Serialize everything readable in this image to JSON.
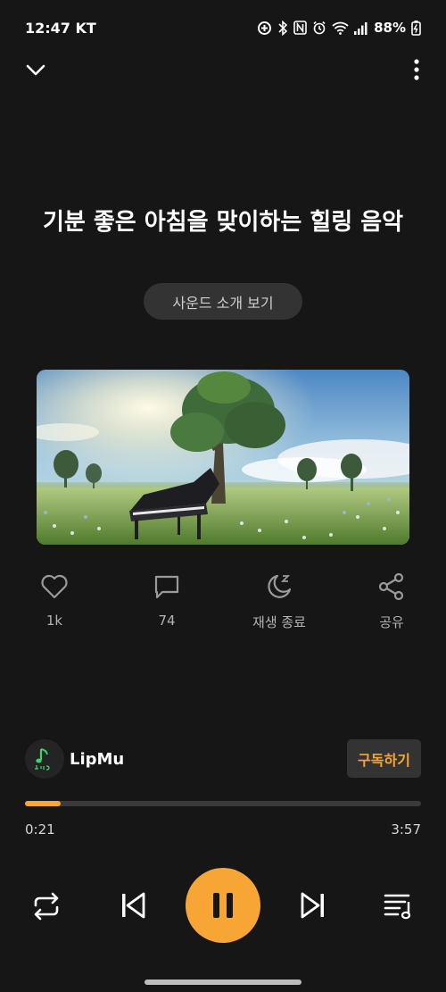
{
  "status_bar": {
    "time": "12:47",
    "carrier": "KT",
    "battery": "88%"
  },
  "track": {
    "title": "기분 좋은 아침을 맞이하는 힐링 음악",
    "intro_button": "사운드 소개 보기"
  },
  "actions": [
    {
      "icon": "heart-icon",
      "label": "1k"
    },
    {
      "icon": "comment-icon",
      "label": "74"
    },
    {
      "icon": "sleep-timer-icon",
      "label": "재생 종료"
    },
    {
      "icon": "share-icon",
      "label": "공유"
    }
  ],
  "channel": {
    "name": "LipMu",
    "subscribe_label": "구독하기"
  },
  "player": {
    "current_time": "0:21",
    "total_time": "3:57",
    "progress": 0.089,
    "state": "playing"
  },
  "colors": {
    "accent": "#f7a534",
    "background": "#161616"
  }
}
